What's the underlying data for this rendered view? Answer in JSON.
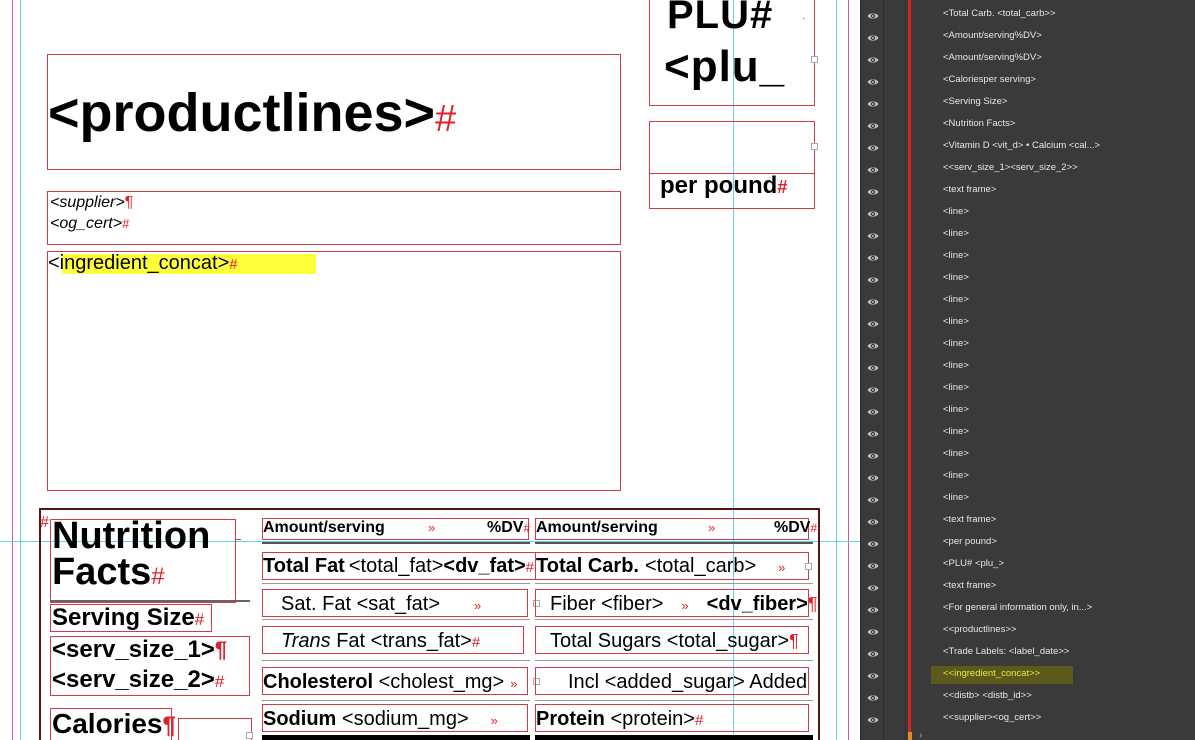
{
  "canvas": {
    "plu_header": "PLU#",
    "plu_field": "<plu_",
    "per_pound": "per pound",
    "productlines": "<productlines>",
    "supplier": "<supplier>",
    "og_cert": "<og_cert>",
    "ingredient_concat": "<ingredient_concat>",
    "nutrition_facts_line1": "Nutrition",
    "nutrition_facts_line2": "Facts",
    "serving_size": "Serving Size",
    "serv_size_1": "<serv_size_1>",
    "serv_size_2": "<serv_size_2>",
    "calories": "Calories",
    "amount_serving_left": "Amount/serving",
    "dv_left": "%DV",
    "amount_serving_right": "Amount/serving",
    "dv_right": "%DV",
    "total_fat_label": "Total Fat",
    "total_fat_value": "<total_fat>",
    "dv_fat": "<dv_fat>",
    "sat_fat_label": "Sat. Fat",
    "sat_fat_value": "<sat_fat>",
    "trans_fat_italic": "Trans",
    "trans_fat_rest": "Fat",
    "trans_fat_value": "<trans_fat>",
    "cholesterol_label": "Cholesterol",
    "cholesterol_value": "<cholest_mg>",
    "sodium_label": "Sodium",
    "sodium_value": "<sodium_mg>",
    "total_carb_label": "Total Carb.",
    "total_carb_value": "<total_carb>",
    "fiber_label": "Fiber",
    "fiber_value": "<fiber>",
    "dv_fiber": "<dv_fiber>",
    "total_sugars_label": "Total Sugars",
    "total_sugars_value": "<total_sugar>",
    "incl_label": "Incl",
    "added_sugar_value": "<added_sugar>",
    "added_label": "Added",
    "protein_label": "Protein",
    "protein_value": "<protein>"
  },
  "layers_panel": {
    "layers": [
      "<Total Carb. <total_carb>>",
      "<Amount/serving%DV>",
      "<Amount/serving%DV>",
      "<Caloriesper serving>",
      "<Serving Size>",
      "<Nutrition Facts>",
      "<Vitamin D <vit_d> • Calcium <cal...>",
      "<<serv_size_1><serv_size_2>>",
      "<text frame>",
      "<line>",
      "<line>",
      "<line>",
      "<line>",
      "<line>",
      "<line>",
      "<line>",
      "<line>",
      "<line>",
      "<line>",
      "<line>",
      "<line>",
      "<line>",
      "<line>",
      "<text frame>",
      "<per pound>",
      "<PLU# <plu_>",
      "<text frame>",
      "<For general information only, in...>",
      "<<productlines>>",
      "<Trade Labels: <label_date>>",
      "<<ingredient_concat>>",
      "<<distb> <distb_id>>",
      "<<supplier><og_cert>>"
    ],
    "highlighted_index": 30,
    "highlight_color": "#5b5a1c",
    "highlight_text_color": "#e8e640",
    "layer_color": "#d2261e"
  },
  "colors": {
    "frame_border": "#d23c48",
    "guide": "#5ed6de",
    "ingredient_highlight": "#ffff3c",
    "hidden_char": "#e0202a"
  }
}
